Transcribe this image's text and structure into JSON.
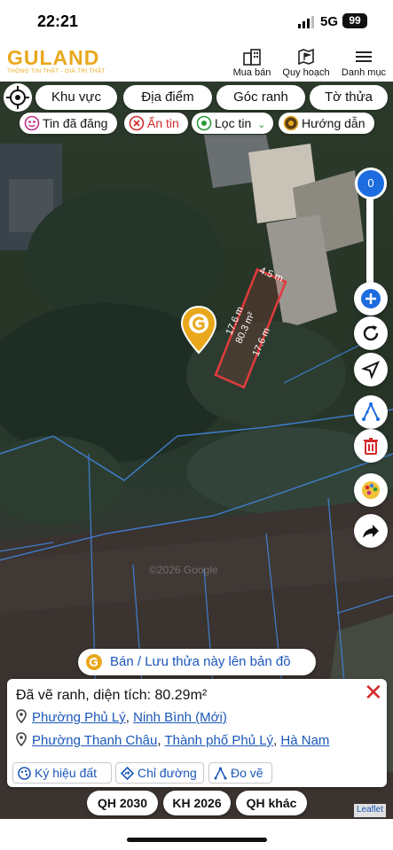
{
  "status_bar": {
    "time": "22:21",
    "network": "5G",
    "battery": "99"
  },
  "header": {
    "logo_text": "GULAND",
    "logo_tagline": "THÔNG TIN THẬT - GIÁ TRỊ THẬT",
    "nav": [
      {
        "label": "Mua bán",
        "icon": "buildings-icon"
      },
      {
        "label": "Quy hoạch",
        "icon": "map-flag-icon"
      },
      {
        "label": "Danh mục",
        "icon": "menu-icon"
      }
    ]
  },
  "filter_tabs": [
    "Khu vực",
    "Địa điểm",
    "Góc ranh",
    "Tờ thửa"
  ],
  "filter_pills": [
    {
      "label": "Tin đã đăng",
      "icon": "posted-icon"
    },
    {
      "label": "Ẩn tin",
      "icon": "hide-icon"
    },
    {
      "label": "Lọc tin",
      "icon": "filter-pin-icon"
    },
    {
      "label": "Hướng dẫn",
      "icon": "guide-icon"
    }
  ],
  "zoom": {
    "value": "0",
    "level_fraction": 0.0
  },
  "map": {
    "parcel": {
      "area_label": "80.3 m²",
      "side_top": "4.5 m",
      "side_left": "17.6 m",
      "side_right": "17.6 m"
    },
    "watermark": "©2026 Google"
  },
  "save_banner": "Bán / Lưu thửa này lên bản đồ",
  "info_card": {
    "title": "Đã vẽ ranh, diện tích: 80.29m²",
    "location_new": {
      "ward": "Phường Phủ Lý",
      "sep": ", ",
      "province": "Ninh Bình (Mới)"
    },
    "location_old": {
      "ward": "Phường Thanh Châu",
      "sep1": ", ",
      "city": "Thành phố Phủ Lý",
      "sep2": ", ",
      "province": "Hà Nam"
    },
    "actions": [
      {
        "label": "Ký hiệu đất",
        "icon": "palette-icon"
      },
      {
        "label": "Chỉ đường",
        "icon": "directions-icon"
      },
      {
        "label": "Đo vẽ",
        "icon": "measure-icon"
      }
    ]
  },
  "planning_buttons": [
    "QH 2030",
    "KH 2026",
    "QH khác"
  ],
  "attribution": "Leaflet",
  "colors": {
    "brand": "#e9a81c",
    "accent_blue": "#1d6ce0",
    "link": "#1b57b8",
    "danger": "#d32a2a",
    "parcel": "#e23b3b"
  }
}
